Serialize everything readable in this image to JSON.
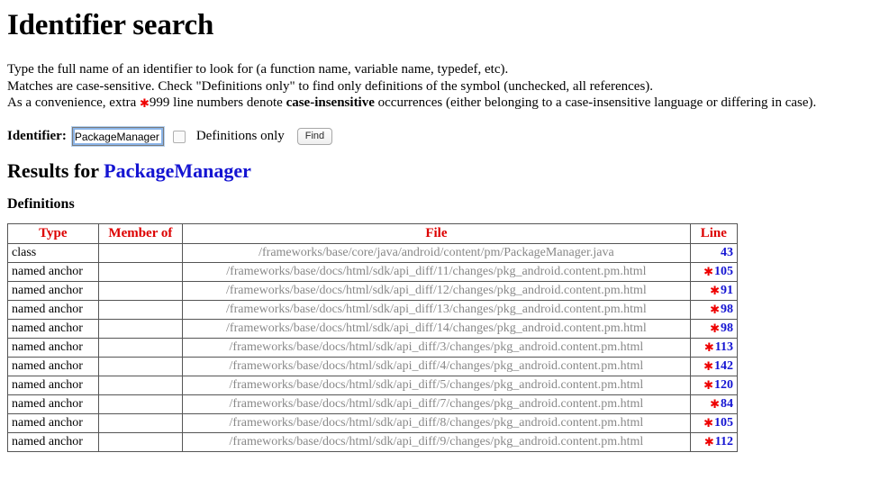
{
  "page": {
    "title": "Identifier search"
  },
  "intro": {
    "line1": "Type the full name of an identifier to look for (a function name, variable name, typedef, etc).",
    "line2": "Matches are case-sensitive. Check \"Definitions only\" to find only definitions of the symbol (unchecked, all references).",
    "line3_pre": "As a convenience, extra ",
    "line3_star": "✱",
    "line3_mid": "999 line numbers denote ",
    "line3_bold": "case-insensitive",
    "line3_post": " occurrences (either belonging to a case-insensitive language or differing in case)."
  },
  "search": {
    "identifier_label": "Identifier:",
    "identifier_value": "PackageManager",
    "identifier_placeholder": "",
    "definitions_only_label": "Definitions only",
    "definitions_only_checked": false,
    "find_label": "Find"
  },
  "results": {
    "heading_prefix": "Results for ",
    "heading_term": "PackageManager",
    "section_title": "Definitions",
    "columns": [
      "Type",
      "Member of",
      "File",
      "Line"
    ],
    "rows": [
      {
        "type": "class",
        "member_of": "",
        "file": "/frameworks/base/core/java/android/content/pm/PackageManager.java",
        "star": "",
        "line": "43"
      },
      {
        "type": "named anchor",
        "member_of": "",
        "file": "/frameworks/base/docs/html/sdk/api_diff/11/changes/pkg_android.content.pm.html",
        "star": "✱",
        "line": "105"
      },
      {
        "type": "named anchor",
        "member_of": "",
        "file": "/frameworks/base/docs/html/sdk/api_diff/12/changes/pkg_android.content.pm.html",
        "star": "✱",
        "line": "91"
      },
      {
        "type": "named anchor",
        "member_of": "",
        "file": "/frameworks/base/docs/html/sdk/api_diff/13/changes/pkg_android.content.pm.html",
        "star": "✱",
        "line": "98"
      },
      {
        "type": "named anchor",
        "member_of": "",
        "file": "/frameworks/base/docs/html/sdk/api_diff/14/changes/pkg_android.content.pm.html",
        "star": "✱",
        "line": "98"
      },
      {
        "type": "named anchor",
        "member_of": "",
        "file": "/frameworks/base/docs/html/sdk/api_diff/3/changes/pkg_android.content.pm.html",
        "star": "✱",
        "line": "113"
      },
      {
        "type": "named anchor",
        "member_of": "",
        "file": "/frameworks/base/docs/html/sdk/api_diff/4/changes/pkg_android.content.pm.html",
        "star": "✱",
        "line": "142"
      },
      {
        "type": "named anchor",
        "member_of": "",
        "file": "/frameworks/base/docs/html/sdk/api_diff/5/changes/pkg_android.content.pm.html",
        "star": "✱",
        "line": "120"
      },
      {
        "type": "named anchor",
        "member_of": "",
        "file": "/frameworks/base/docs/html/sdk/api_diff/7/changes/pkg_android.content.pm.html",
        "star": "✱",
        "line": "84"
      },
      {
        "type": "named anchor",
        "member_of": "",
        "file": "/frameworks/base/docs/html/sdk/api_diff/8/changes/pkg_android.content.pm.html",
        "star": "✱",
        "line": "105"
      },
      {
        "type": "named anchor",
        "member_of": "",
        "file": "/frameworks/base/docs/html/sdk/api_diff/9/changes/pkg_android.content.pm.html",
        "star": "✱",
        "line": "112"
      }
    ]
  },
  "colors": {
    "header_red": "#dd0000",
    "link_blue": "#1414d2",
    "file_gray": "#888888",
    "star_red": "#ee0000"
  }
}
